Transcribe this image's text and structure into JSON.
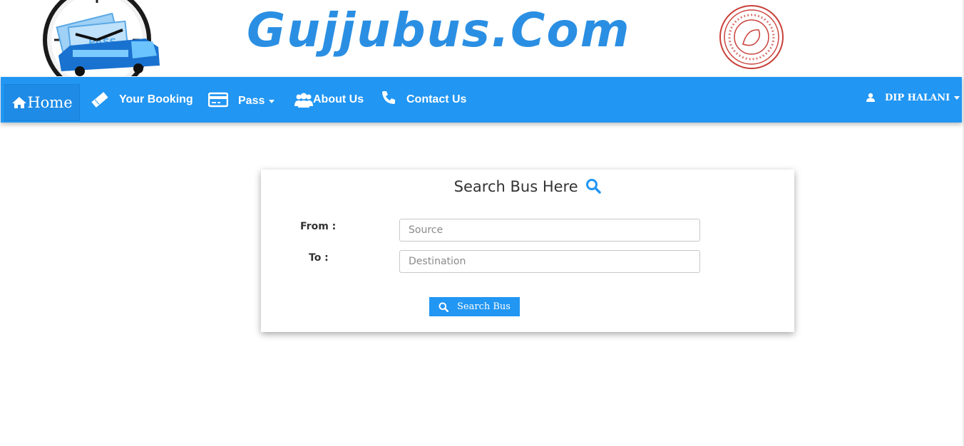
{
  "header": {
    "site_title": "Gujjubus.Com",
    "logo_left_icon": "bus-pass-clock-logo",
    "logo_right_icon": "gsrtc-seal-logo"
  },
  "nav": {
    "home": "Home",
    "booking": "Your Booking",
    "pass": "Pass",
    "about": "About Us",
    "contact": "Contact Us",
    "user": "DIP HALANI"
  },
  "search": {
    "title": "Search Bus Here",
    "from_label": "From :",
    "to_label": "To :",
    "source_placeholder": "Source",
    "destination_placeholder": "Destination",
    "button_label": "Search Bus"
  },
  "colors": {
    "brand_blue": "#2196f3",
    "title_blue": "#2a8fe3"
  }
}
